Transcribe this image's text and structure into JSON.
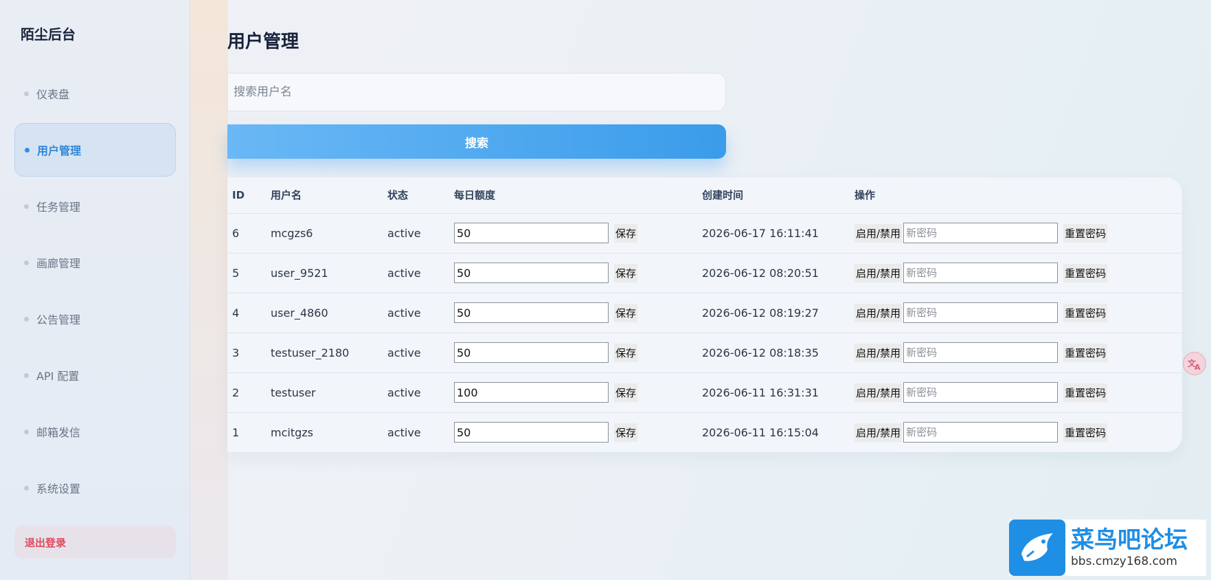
{
  "sidebar": {
    "brand": "陌尘后台",
    "items": [
      {
        "label": "仪表盘"
      },
      {
        "label": "用户管理"
      },
      {
        "label": "任务管理"
      },
      {
        "label": "画廊管理"
      },
      {
        "label": "公告管理"
      },
      {
        "label": "API 配置"
      },
      {
        "label": "邮箱发信"
      },
      {
        "label": "系统设置"
      }
    ],
    "active_index": 1,
    "logout": "退出登录"
  },
  "main": {
    "title": "用户管理",
    "search": {
      "placeholder": "搜索用户名",
      "value": "",
      "button": "搜索"
    },
    "table": {
      "headers": [
        "ID",
        "用户名",
        "状态",
        "每日额度",
        "创建时间",
        "操作"
      ],
      "rows": [
        {
          "id": "6",
          "username": "mcgzs6",
          "status": "active",
          "quota": "50",
          "created": "2026-06-17 16:11:41"
        },
        {
          "id": "5",
          "username": "user_9521",
          "status": "active",
          "quota": "50",
          "created": "2026-06-12 08:20:51"
        },
        {
          "id": "4",
          "username": "user_4860",
          "status": "active",
          "quota": "50",
          "created": "2026-06-12 08:19:27"
        },
        {
          "id": "3",
          "username": "testuser_2180",
          "status": "active",
          "quota": "50",
          "created": "2026-06-12 08:18:35"
        },
        {
          "id": "2",
          "username": "testuser",
          "status": "active",
          "quota": "100",
          "created": "2026-06-11 16:31:31"
        },
        {
          "id": "1",
          "username": "mcitgzs",
          "status": "active",
          "quota": "50",
          "created": "2026-06-11 16:15:04"
        }
      ],
      "actions": {
        "save": "保存",
        "toggle": "启用/禁用",
        "password_placeholder": "新密码",
        "reset": "重置密码"
      }
    }
  },
  "watermark": {
    "title": "菜鸟吧论坛",
    "url": "bbs.cmzy168.com"
  },
  "colors": {
    "accent": "#2f8ef0",
    "logout": "#e0485a"
  }
}
